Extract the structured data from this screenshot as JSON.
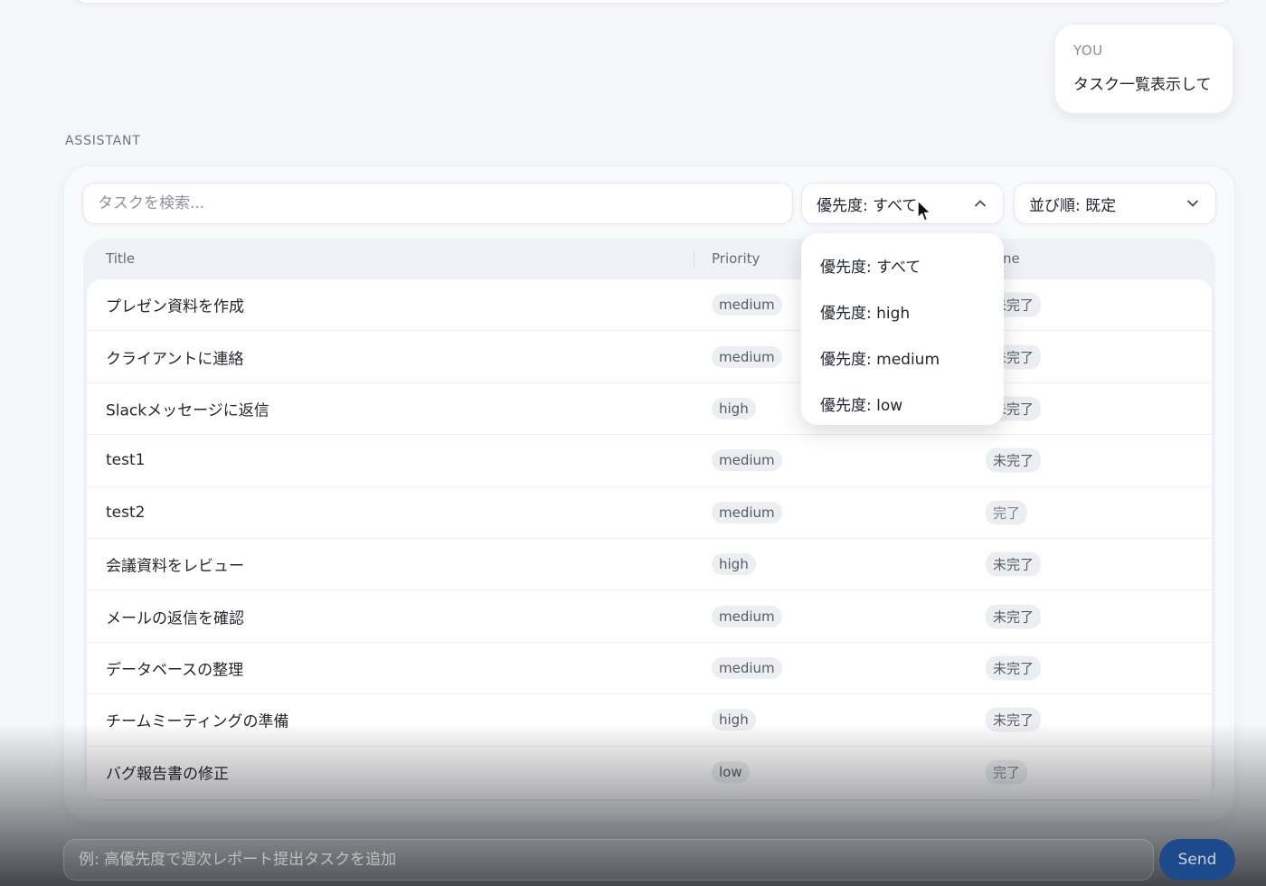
{
  "user_message": {
    "role": "YOU",
    "text": "タスク一覧表示して"
  },
  "assistant_label": "ASSISTANT",
  "filters": {
    "search_placeholder": "タスクを検索...",
    "priority_select": "優先度: すべて",
    "sort_select": "並び順: 既定"
  },
  "table": {
    "headers": {
      "title": "Title",
      "priority": "Priority",
      "done": "ne"
    },
    "rows": [
      {
        "title": "プレゼン資料を作成",
        "priority": "medium",
        "done": "未完了"
      },
      {
        "title": "クライアントに連絡",
        "priority": "medium",
        "done": "未完了"
      },
      {
        "title": "Slackメッセージに返信",
        "priority": "high",
        "done": "未完了"
      },
      {
        "title": "test1",
        "priority": "medium",
        "done": "未完了"
      },
      {
        "title": "test2",
        "priority": "medium",
        "done": "完了"
      },
      {
        "title": "会議資料をレビュー",
        "priority": "high",
        "done": "未完了"
      },
      {
        "title": "メールの返信を確認",
        "priority": "medium",
        "done": "未完了"
      },
      {
        "title": "データベースの整理",
        "priority": "medium",
        "done": "未完了"
      },
      {
        "title": "チームミーティングの準備",
        "priority": "high",
        "done": "未完了"
      },
      {
        "title": "バグ報告書の修正",
        "priority": "low",
        "done": "完了"
      }
    ]
  },
  "priority_dropdown": {
    "options": [
      "優先度: すべて",
      "優先度: high",
      "優先度: medium",
      "優先度: low"
    ]
  },
  "composer": {
    "placeholder": "例: 高優先度で週次レポート提出タスクを追加",
    "send_label": "Send"
  },
  "icons": {
    "priority_select": "chevron-up-icon",
    "sort_select": "chevron-down-icon",
    "cursor": "mouse-pointer-icon"
  },
  "colors": {
    "send_button": "#1d4a8a",
    "badge_bg": "#eceef1",
    "page_bg": "#f6f7fa"
  }
}
